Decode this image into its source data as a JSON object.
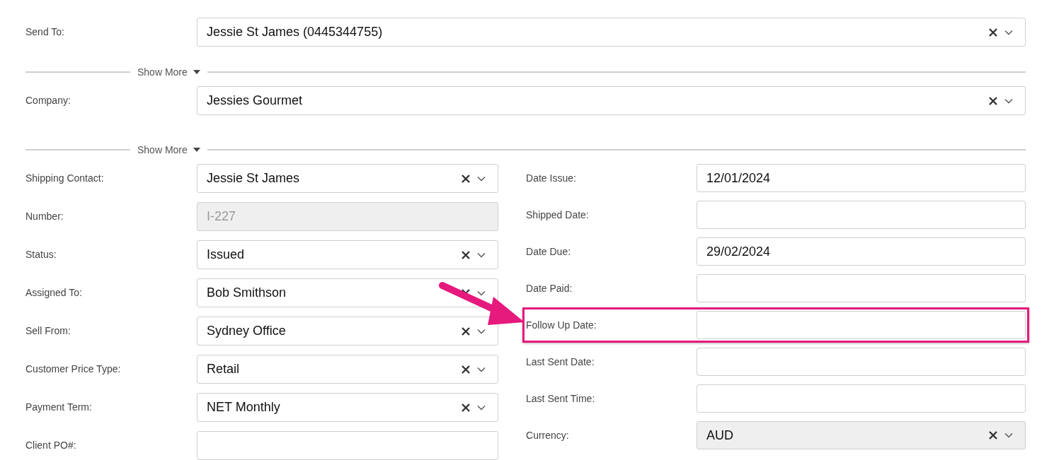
{
  "top_fields": [
    {
      "label": "Send To:",
      "kind": "select",
      "value": "Jessie St James (0445344755)",
      "disabled": false
    },
    {
      "kind": "divider",
      "label": "Show More"
    },
    {
      "label": "Company:",
      "kind": "select",
      "value": "Jessies Gourmet",
      "disabled": false
    },
    {
      "kind": "divider",
      "label": "Show More"
    }
  ],
  "left_fields": [
    {
      "label": "Shipping Contact:",
      "kind": "select",
      "value": "Jessie St James",
      "disabled": false
    },
    {
      "label": "Number:",
      "kind": "input",
      "value": "I-227",
      "disabled": true
    },
    {
      "label": "Status:",
      "kind": "select",
      "value": "Issued",
      "disabled": false
    },
    {
      "label": "Assigned To:",
      "kind": "select",
      "value": "Bob Smithson",
      "disabled": false
    },
    {
      "label": "Sell From:",
      "kind": "select",
      "value": "Sydney Office",
      "disabled": false
    },
    {
      "label": "Customer Price Type:",
      "kind": "select",
      "value": "Retail",
      "disabled": false
    },
    {
      "label": "Payment Term:",
      "kind": "select",
      "value": "NET Monthly",
      "disabled": false
    },
    {
      "label": "Client PO#:",
      "kind": "input",
      "disabled": false
    }
  ],
  "right_fields": [
    {
      "label": "Date Issue:",
      "kind": "input",
      "value": "12/01/2024",
      "disabled": false,
      "highlighted": false
    },
    {
      "label": "Shipped Date:",
      "kind": "input",
      "disabled": false,
      "highlighted": false
    },
    {
      "label": "Date Due:",
      "kind": "input",
      "value": "29/02/2024",
      "disabled": false,
      "highlighted": false
    },
    {
      "label": "Date Paid:",
      "kind": "input",
      "disabled": false,
      "highlighted": false
    },
    {
      "label": "Follow Up Date:",
      "kind": "input",
      "disabled": false,
      "highlighted": true
    },
    {
      "label": "Last Sent Date:",
      "kind": "input",
      "disabled": false,
      "highlighted": false
    },
    {
      "label": "Last Sent Time:",
      "kind": "input",
      "disabled": false,
      "highlighted": false
    },
    {
      "label": "Currency:",
      "kind": "select",
      "value": "AUD",
      "disabled": true,
      "highlighted": false
    }
  ]
}
